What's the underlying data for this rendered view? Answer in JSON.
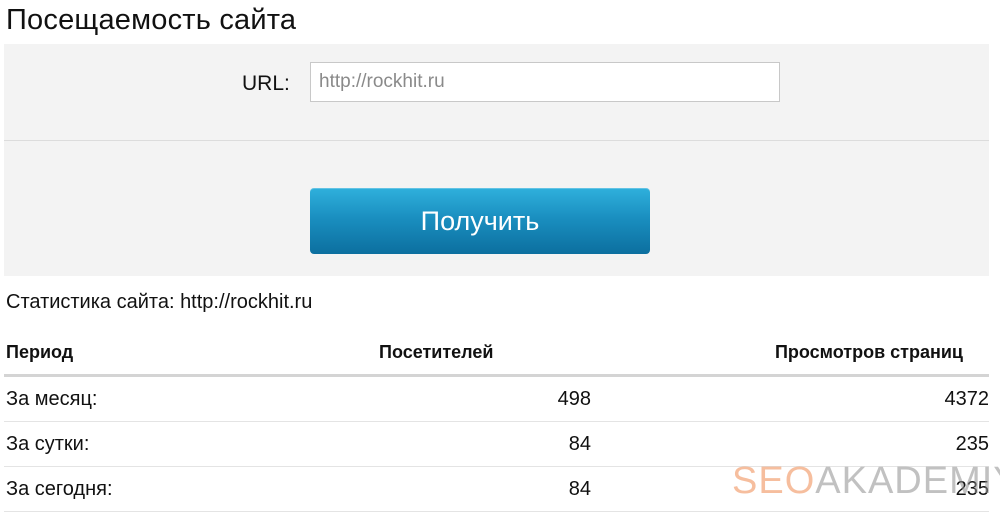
{
  "page": {
    "title": "Посещаемость сайта"
  },
  "form": {
    "url_label": "URL:",
    "url_placeholder": "http://rockhit.ru",
    "url_value": "",
    "submit_label": "Получить"
  },
  "stats": {
    "caption": "Статистика сайта: http://rockhit.ru",
    "columns": [
      "Период",
      "Посетителей",
      "Просмотров страниц"
    ],
    "rows": [
      {
        "period": "За месяц:",
        "visitors": "498",
        "views": "4372"
      },
      {
        "period": "За сутки:",
        "visitors": "84",
        "views": "235"
      },
      {
        "period": "За сегодня:",
        "visitors": "84",
        "views": "235"
      }
    ]
  },
  "watermark": {
    "part1": "SEO",
    "part2": "AKADEMIYA"
  },
  "colors": {
    "button_top": "#2fb0dc",
    "button_bottom": "#0c6f9f",
    "panel_bg": "#f3f3f3",
    "watermark_accent": "#f08a50"
  }
}
